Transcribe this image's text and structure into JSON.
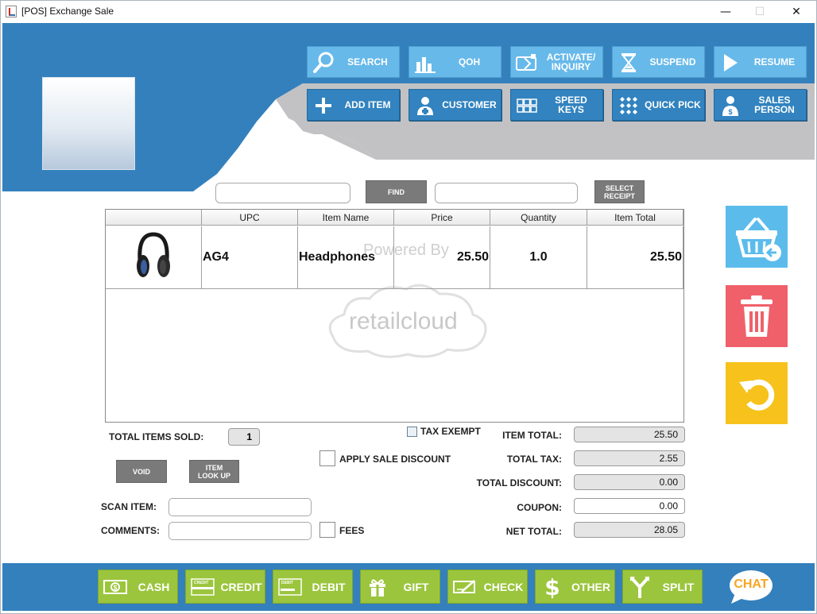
{
  "window": {
    "title": "[POS] Exchange Sale",
    "controls": {
      "minimize": "—",
      "maximize": "☐",
      "close": "✕"
    }
  },
  "toolbar": {
    "row1": [
      {
        "label": "SEARCH",
        "icon": "search-icon"
      },
      {
        "label": "QOH",
        "icon": "bar-chart-icon"
      },
      {
        "label": "ACTIVATE/\nINQUIRY",
        "icon": "card-activate-icon"
      },
      {
        "label": "SUSPEND",
        "icon": "hourglass-icon"
      },
      {
        "label": "RESUME",
        "icon": "play-icon"
      }
    ],
    "row2": [
      {
        "label": "ADD ITEM",
        "icon": "plus-icon"
      },
      {
        "label": "CUSTOMER",
        "icon": "add-user-icon"
      },
      {
        "label": "SPEED KEYS",
        "icon": "keypad-icon"
      },
      {
        "label": "QUICK PICK",
        "icon": "grid-dots-icon"
      },
      {
        "label": "SALES\nPERSON",
        "icon": "salesperson-icon"
      }
    ]
  },
  "search": {
    "find_label": "FIND",
    "select_receipt_label": "SELECT\nRECEIPT"
  },
  "grid": {
    "columns": [
      "",
      "UPC",
      "Item Name",
      "Price",
      "Quantity",
      "Item Total"
    ],
    "rows": [
      {
        "image": "headphones-image",
        "upc": "AG4",
        "item_name": "Headphones",
        "price": "25.50",
        "quantity": "1.0",
        "item_total": "25.50"
      }
    ],
    "watermark": {
      "powered_by": "Powered By",
      "brand": "retailcloud"
    }
  },
  "summary": {
    "total_items_sold_label": "TOTAL ITEMS SOLD:",
    "total_items_sold": "1",
    "tax_exempt_label": "TAX EXEMPT",
    "apply_sale_discount_label": "APPLY SALE DISCOUNT",
    "fees_label": "FEES",
    "void_label": "VOID",
    "item_lookup_label": "ITEM\nLOOK UP",
    "scan_item_label": "SCAN ITEM:",
    "comments_label": "COMMENTS:",
    "item_total_label": "ITEM TOTAL:",
    "item_total": "25.50",
    "total_tax_label": "TOTAL TAX:",
    "total_tax": "2.55",
    "total_discount_label": "TOTAL DISCOUNT:",
    "total_discount": "0.00",
    "coupon_label": "COUPON:",
    "coupon": "0.00",
    "net_total_label": "NET TOTAL:",
    "net_total": "28.05"
  },
  "side_actions": [
    {
      "name": "return-basket",
      "icon": "basket-return-icon",
      "color": "#5bbcec"
    },
    {
      "name": "delete",
      "icon": "trash-icon",
      "color": "#f0606a"
    },
    {
      "name": "undo",
      "icon": "undo-icon",
      "color": "#f6c21b"
    }
  ],
  "payments": [
    {
      "label": "CASH",
      "icon": "cash-icon"
    },
    {
      "label": "CREDIT",
      "icon": "credit-card-icon"
    },
    {
      "label": "DEBIT",
      "icon": "debit-card-icon"
    },
    {
      "label": "GIFT",
      "icon": "gift-icon"
    },
    {
      "label": "CHECK",
      "icon": "check-icon"
    },
    {
      "label": "OTHER",
      "icon": "dollar-icon"
    },
    {
      "label": "SPLIT",
      "icon": "split-icon"
    }
  ],
  "chat_label": "CHAT",
  "card_labels": {
    "credit": "CREDIT",
    "debit": "DEBIT"
  },
  "colors": {
    "blue_band": "#3380bd",
    "grey_band": "#c2c2c4",
    "toolbar_light": "#67b9ea",
    "toolbar_dark": "#3283bf",
    "payment_green": "#9bc53d"
  }
}
